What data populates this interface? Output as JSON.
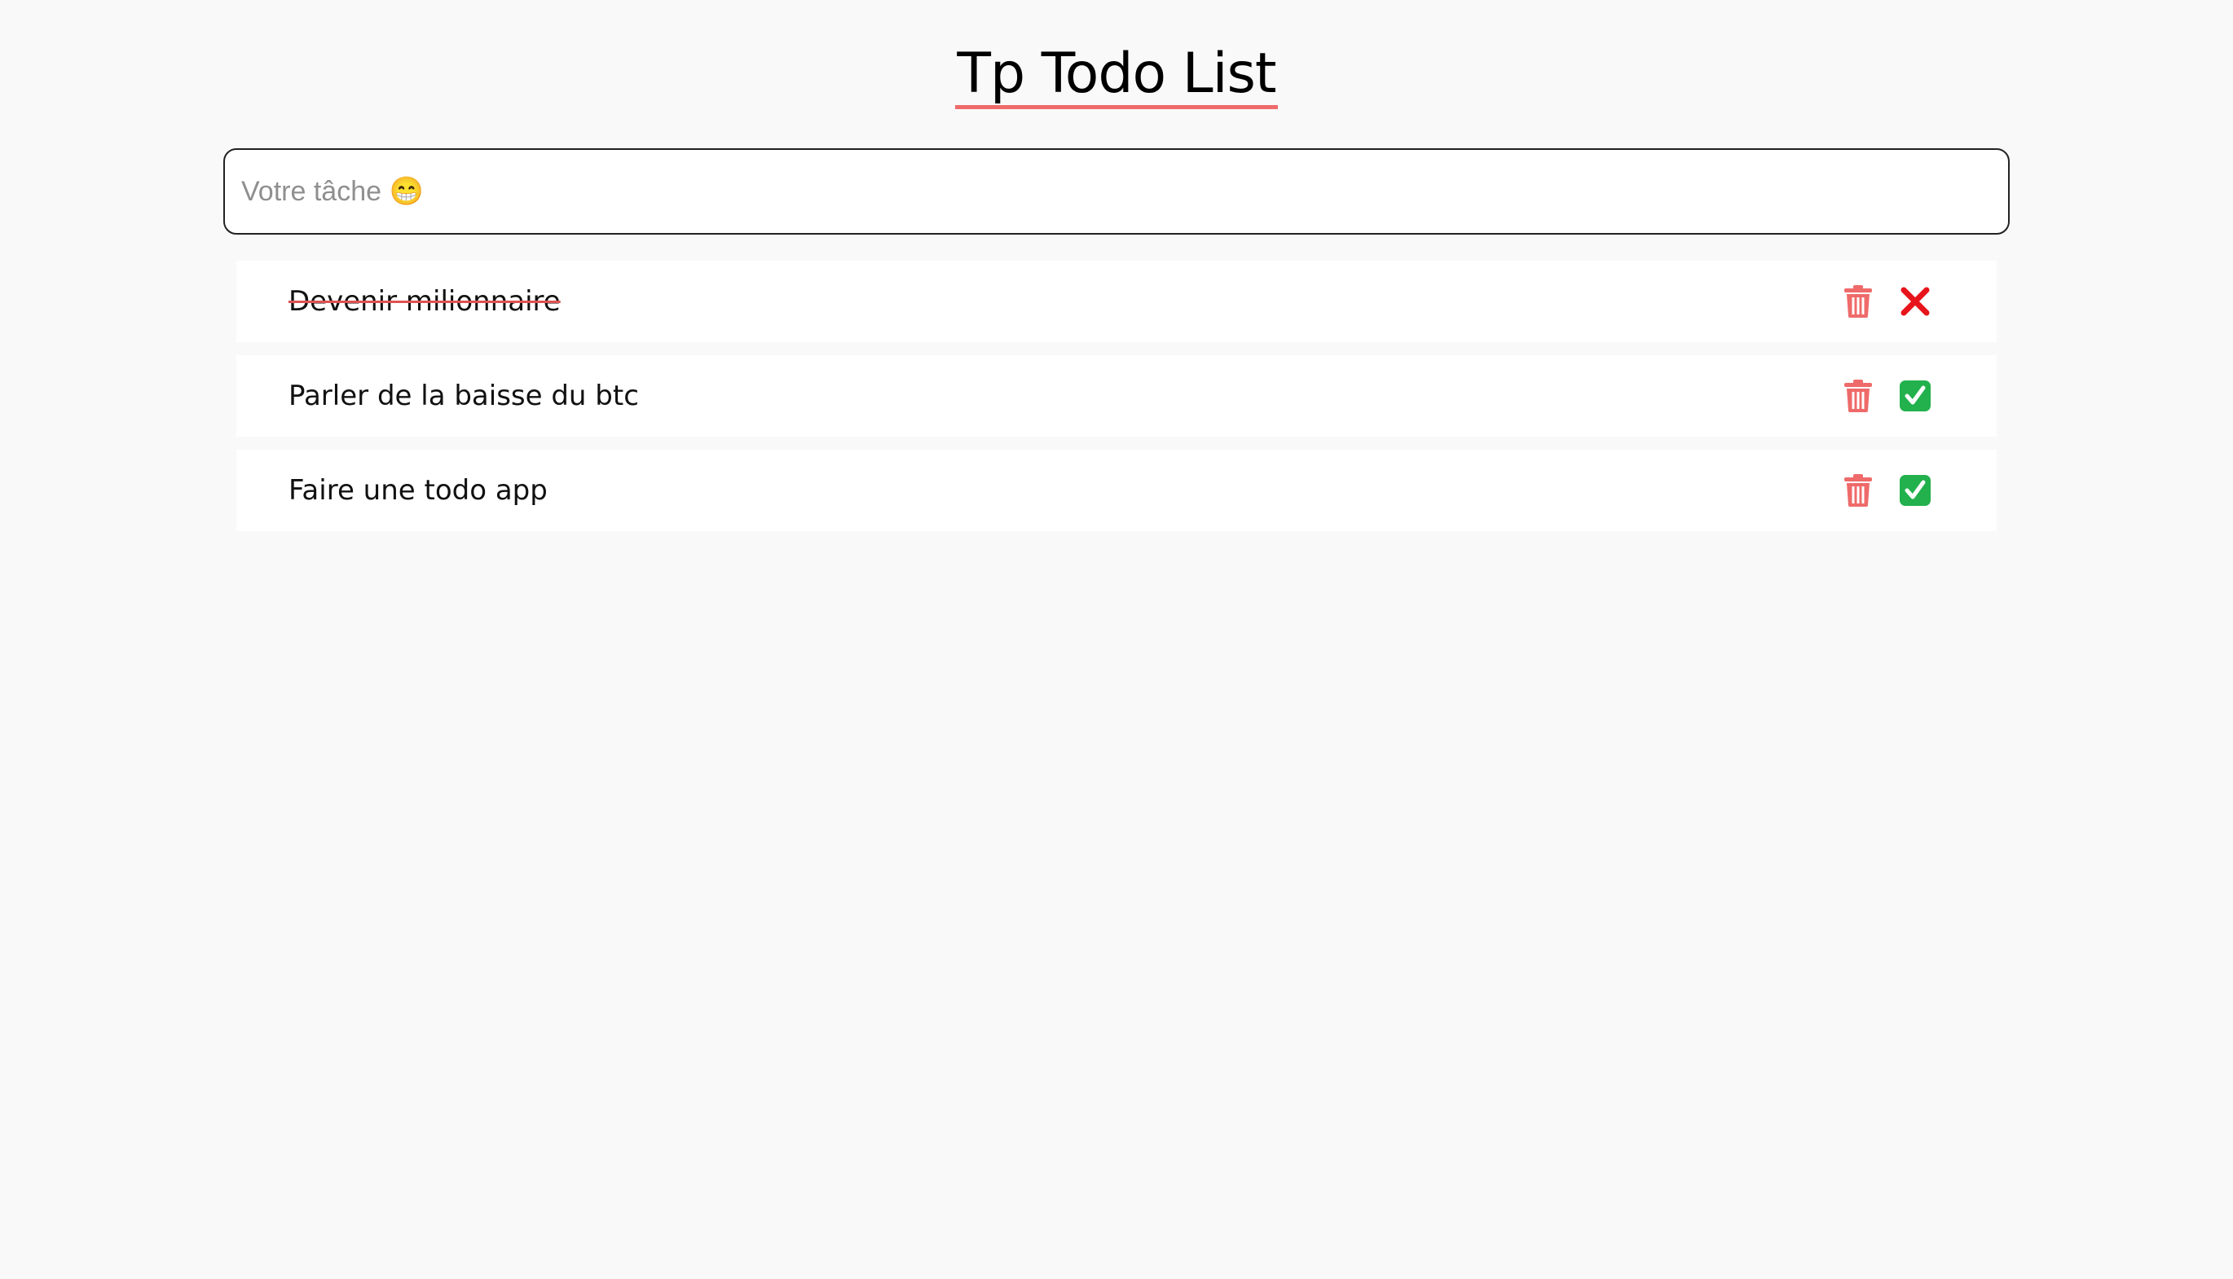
{
  "header": {
    "title": "Tp Todo List"
  },
  "input": {
    "placeholder": "Votre tâche 😁",
    "value": ""
  },
  "todos": [
    {
      "text": "Devenir milionnaire",
      "done": true,
      "status_icon": "cross-icon"
    },
    {
      "text": "Parler de la baisse du btc",
      "done": false,
      "status_icon": "check-box-icon"
    },
    {
      "text": "Faire une todo app",
      "done": false,
      "status_icon": "check-box-icon"
    }
  ],
  "colors": {
    "background": "#f9f9f9",
    "accent_underline": "#ef6a6a",
    "trash": "#ef6a6a",
    "cross": "#e8141b",
    "check": "#22b14c"
  }
}
